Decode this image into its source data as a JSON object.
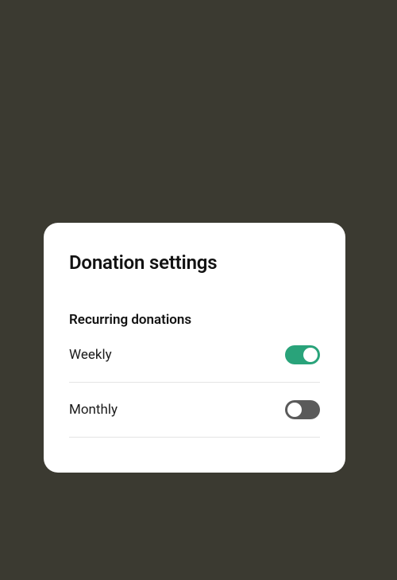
{
  "card": {
    "title": "Donation settings",
    "section_title": "Recurring donations",
    "items": [
      {
        "label": "Weekly",
        "on": true
      },
      {
        "label": "Monthly",
        "on": false
      }
    ]
  },
  "colors": {
    "background": "#3b3a31",
    "card_bg": "#ffffff",
    "toggle_on": "#29a37a",
    "toggle_off": "#5a5a5a",
    "divider": "#e4e4e4"
  }
}
